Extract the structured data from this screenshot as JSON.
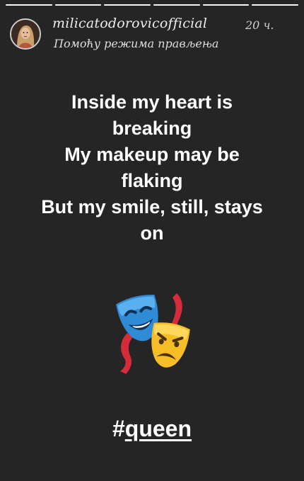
{
  "story": {
    "progress": [
      1,
      1,
      1,
      1,
      1,
      1
    ],
    "username": "milicatodorovicofficial",
    "time_ago": "20 ч.",
    "subtitle": "Помоћу режима прављења",
    "lines": [
      "Inside my heart is",
      "breaking",
      "My makeup may be",
      "flaking",
      "But my smile, still, stays",
      "on"
    ],
    "sticker_icon": "performing-arts-masks-icon",
    "hashtag_symbol": "#",
    "hashtag_word": "queen"
  }
}
